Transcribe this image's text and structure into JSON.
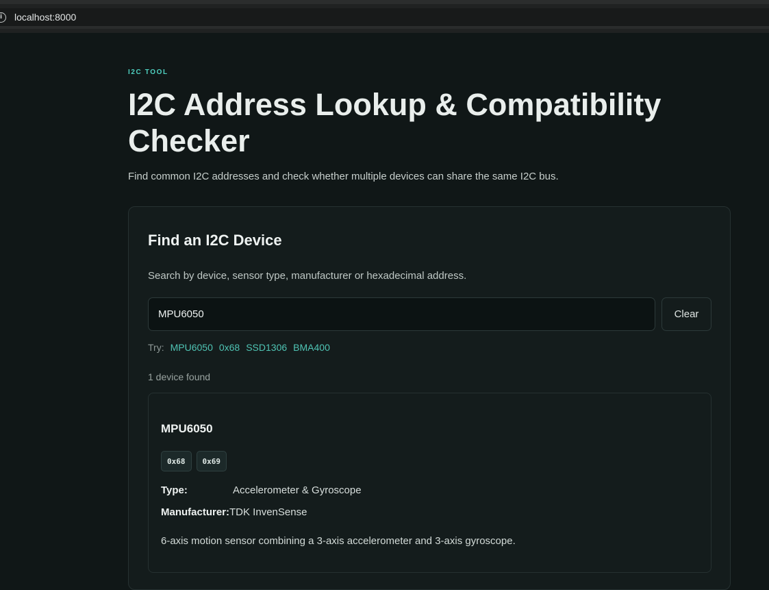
{
  "browser": {
    "url": "localhost:8000"
  },
  "header": {
    "eyebrow": "I2C TOOL",
    "title": "I2C Address Lookup & Compatibility Checker",
    "subtitle": "Find common I2C addresses and check whether multiple devices can share the same I2C bus."
  },
  "finder": {
    "title": "Find an I2C Device",
    "description": "Search by device, sensor type, manufacturer or hexadecimal address.",
    "search_value": "MPU6050",
    "clear_label": "Clear",
    "try_label": "Try:",
    "suggestions": [
      "MPU6050",
      "0x68",
      "SSD1306",
      "BMA400"
    ],
    "result_count": "1 device found"
  },
  "device": {
    "name": "MPU6050",
    "addresses": [
      "0x68",
      "0x69"
    ],
    "type_label": "Type:",
    "type_value": "Accelerometer & Gyroscope",
    "manufacturer_label": "Manufacturer:",
    "manufacturer_value": "TDK InvenSense",
    "description": "6-axis motion sensor combining a 3-axis accelerometer and 3-axis gyroscope."
  },
  "colors": {
    "background": "#101717",
    "accent": "#4fd1c1",
    "card": "#141c1c"
  }
}
